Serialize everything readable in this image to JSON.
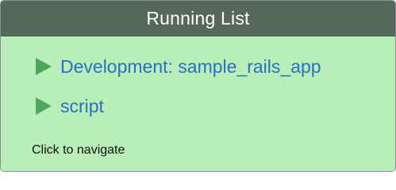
{
  "window": {
    "title": "Running List"
  },
  "list": {
    "items": [
      {
        "label": "Development: sample_rails_app",
        "icon": "play-triangle-icon"
      },
      {
        "label": "script",
        "icon": "play-triangle-icon"
      }
    ]
  },
  "footer": {
    "hint": "Click to navigate"
  },
  "colors": {
    "title_bar": "#56685a",
    "background": "#b8efb8",
    "link_text": "#2a6fc4",
    "play_icon": "#4fa65b"
  }
}
